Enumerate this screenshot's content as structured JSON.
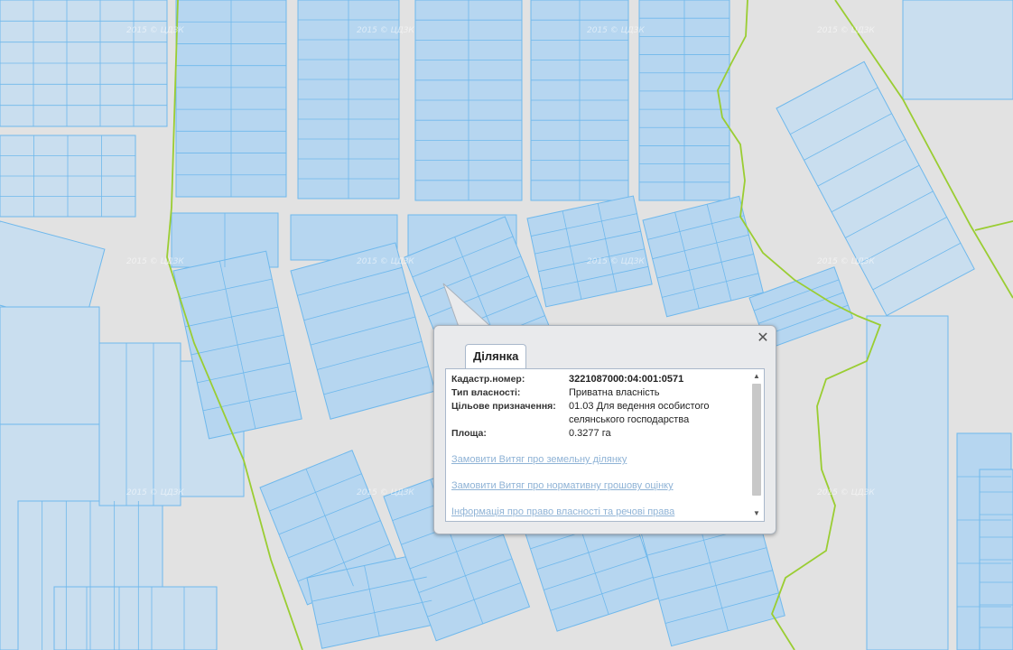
{
  "map": {
    "watermark": "2015 © ЦДЗК",
    "colors": {
      "background": "#e2e2e2",
      "parcel_fill": "#b6d6f0",
      "parcel_stroke": "#6fb8ec",
      "boundary": "#9acd32"
    }
  },
  "popup": {
    "tab_label": "Ділянка",
    "close_icon": "close-icon",
    "fields": [
      {
        "label": "Кадастр.номер:",
        "value": "3221087000:04:001:0571"
      },
      {
        "label": "Тип власності:",
        "value": "Приватна власність"
      },
      {
        "label": "Цільове призначення:",
        "value": "01.03 Для ведення особистого селянського господарства"
      },
      {
        "label": "Площа:",
        "value": "0.3277 га"
      }
    ],
    "links": [
      "Замовити Витяг про земельну ділянку",
      "Замовити Витяг про нормативну грошову оцінку",
      "Інформація про право власності та речові права"
    ],
    "scroll_up_icon": "▲",
    "scroll_down_icon": "▼"
  }
}
